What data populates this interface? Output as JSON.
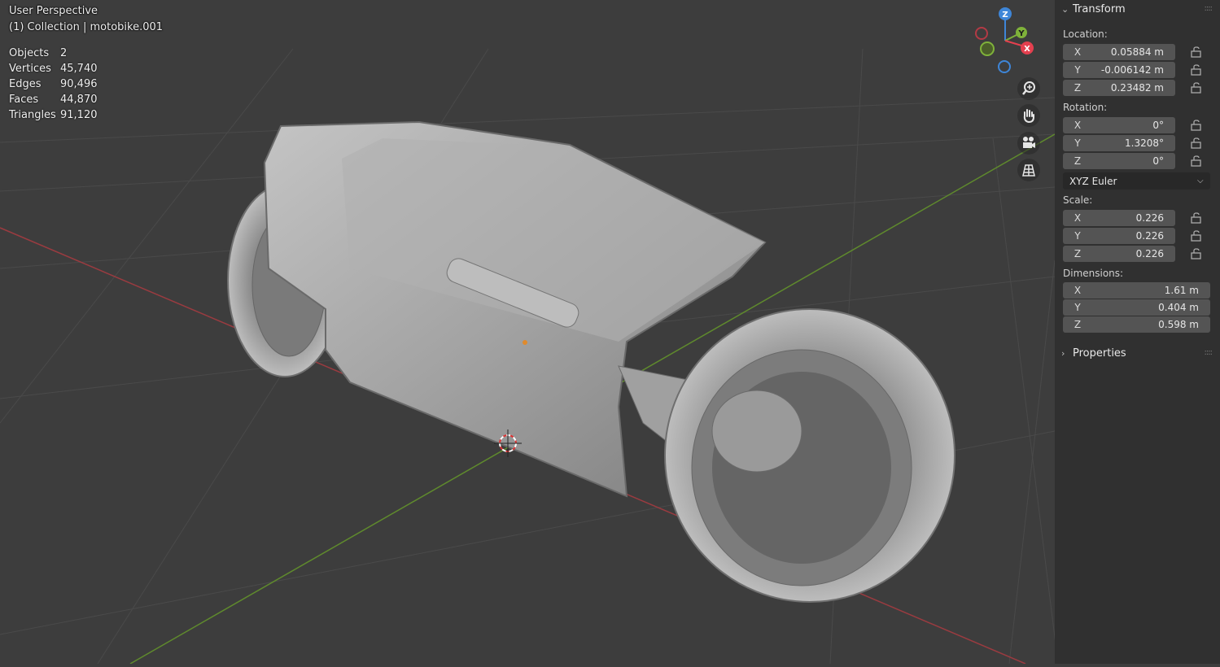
{
  "viewport": {
    "view_name": "User Perspective",
    "collection_info": "(1) Collection | motobike.001",
    "stats": [
      {
        "label": "Objects",
        "value": "2"
      },
      {
        "label": "Vertices",
        "value": "45,740"
      },
      {
        "label": "Edges",
        "value": "90,496"
      },
      {
        "label": "Faces",
        "value": "44,870"
      },
      {
        "label": "Triangles",
        "value": "91,120"
      }
    ],
    "gizmo": {
      "z": "Z",
      "y": "Y",
      "x": "X"
    },
    "nav_tools": [
      "zoom-icon",
      "hand-pan-icon",
      "camera-icon",
      "grid-ortho-icon"
    ]
  },
  "npanel": {
    "transform": {
      "title": "Transform",
      "location_label": "Location:",
      "location": [
        {
          "axis": "X",
          "value": "0.05884 m"
        },
        {
          "axis": "Y",
          "value": "-0.006142 m"
        },
        {
          "axis": "Z",
          "value": "0.23482 m"
        }
      ],
      "rotation_label": "Rotation:",
      "rotation": [
        {
          "axis": "X",
          "value": "0°"
        },
        {
          "axis": "Y",
          "value": "1.3208°"
        },
        {
          "axis": "Z",
          "value": "0°"
        }
      ],
      "rotation_mode": "XYZ Euler",
      "scale_label": "Scale:",
      "scale": [
        {
          "axis": "X",
          "value": "0.226"
        },
        {
          "axis": "Y",
          "value": "0.226"
        },
        {
          "axis": "Z",
          "value": "0.226"
        }
      ],
      "dimensions_label": "Dimensions:",
      "dimensions": [
        {
          "axis": "X",
          "value": "1.61 m"
        },
        {
          "axis": "Y",
          "value": "0.404 m"
        },
        {
          "axis": "Z",
          "value": "0.598 m"
        }
      ]
    },
    "properties": {
      "title": "Properties"
    }
  },
  "colors": {
    "background": "#3d3d3d",
    "panel": "#303030",
    "axis_x": "#e4404f",
    "axis_y": "#7fb23a",
    "axis_z": "#3e86d8",
    "model": "#a9a9a9"
  }
}
